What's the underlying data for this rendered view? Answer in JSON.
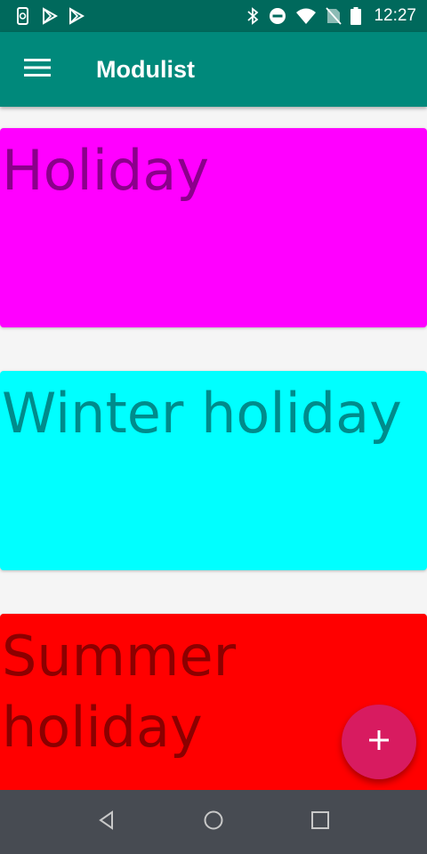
{
  "status_bar": {
    "time": "12:27",
    "left_icons": [
      "phone-sync-icon",
      "play-store-icon",
      "play-store-icon"
    ],
    "right_icons": [
      "bluetooth-icon",
      "do-not-disturb-icon",
      "wifi-icon",
      "no-sim-icon",
      "battery-icon"
    ]
  },
  "app_bar": {
    "title": "Modulist",
    "menu_icon": "hamburger-menu-icon",
    "color": "#00897b",
    "status_color": "#00695c"
  },
  "cards": [
    {
      "title": "Holiday",
      "color": "#ff00ff"
    },
    {
      "title": "Winter holiday",
      "color": "#00ffff"
    },
    {
      "title": "Summer holiday",
      "color": "#ff0000"
    }
  ],
  "fab": {
    "icon": "plus-icon",
    "color": "#d81b60"
  },
  "nav_bar": {
    "buttons": [
      "back-icon",
      "home-icon",
      "recents-icon"
    ],
    "color": "#474b52"
  }
}
